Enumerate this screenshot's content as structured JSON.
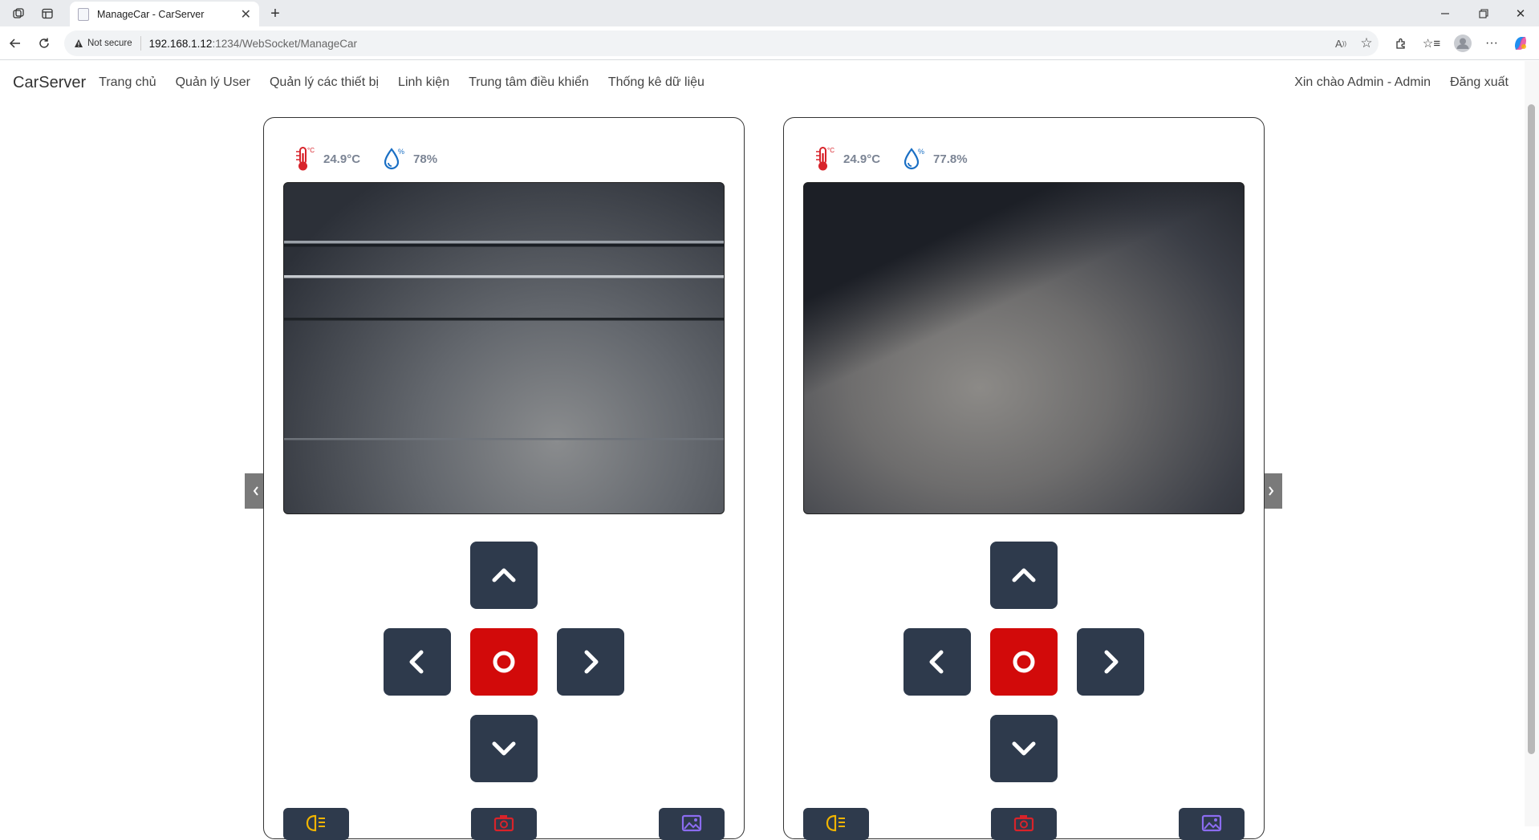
{
  "browser": {
    "tab_title": "ManageCar - CarServer",
    "not_secure_label": "Not secure",
    "url_host": "192.168.1.12",
    "url_path": ":1234/WebSocket/ManageCar"
  },
  "navbar": {
    "brand": "CarServer",
    "items": [
      {
        "label": "Trang chủ"
      },
      {
        "label": "Quản lý User"
      },
      {
        "label": "Quản lý các thiết bị"
      },
      {
        "label": "Linh kiện"
      },
      {
        "label": "Trung tâm điều khiển"
      },
      {
        "label": "Thống kê dữ liệu"
      }
    ],
    "greeting": "Xin chào Admin - Admin",
    "logout": "Đăng xuất"
  },
  "cars": [
    {
      "temperature": "24.9°C",
      "humidity": "78%"
    },
    {
      "temperature": "24.9°C",
      "humidity": "77.8%"
    }
  ],
  "colors": {
    "control_button": "#2e3a4c",
    "stop_button": "#d20a0a",
    "sensor_text": "#7b8494",
    "temperature_icon": "#d8232a",
    "humidity_icon": "#1a6fc4",
    "light_icon": "#f0b400",
    "camera_icon": "#d8232a",
    "image_icon": "#8b6cf0"
  },
  "icons": {
    "temperature": "thermometer-celsius-icon",
    "humidity": "water-drop-percent-icon",
    "forward": "chevron-up-icon",
    "left": "chevron-left-icon",
    "stop": "circle-icon",
    "right": "chevron-right-icon",
    "backward": "chevron-down-icon",
    "light": "headlight-icon",
    "camera": "camera-icon",
    "image": "image-icon"
  }
}
